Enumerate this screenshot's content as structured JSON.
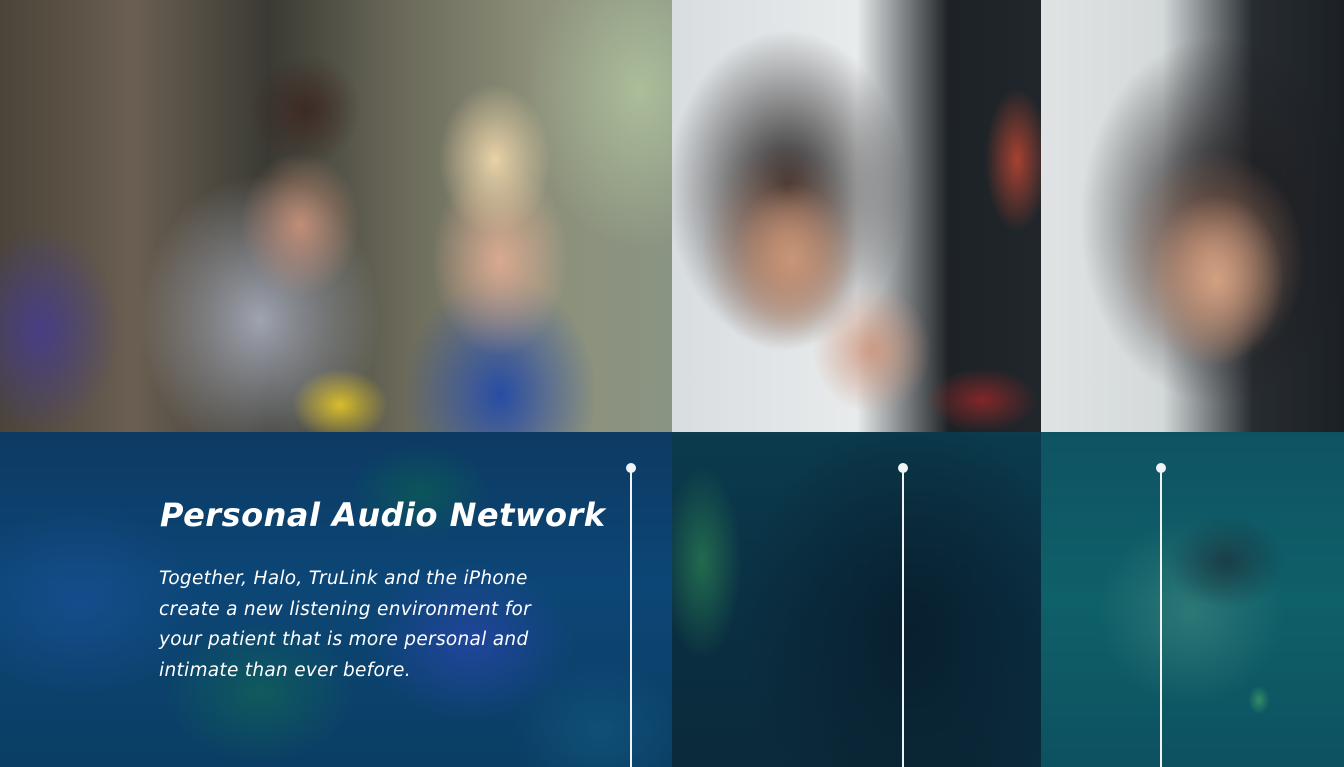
{
  "hero": {
    "title": "Personal Audio Network",
    "body": "Together, Halo, TruLink and the iPhone create a new listening environment for your patient that is more personal and intimate than ever before."
  },
  "photos": [
    {
      "subject": "blurred-couple-photo"
    },
    {
      "subject": "woman-on-phone-photo"
    },
    {
      "subject": "woman-looking-at-phone-photo"
    }
  ],
  "colors": {
    "overlay_blue": "#0c4676",
    "overlay_dark_teal": "#0a3043",
    "overlay_teal": "#0e6069",
    "line": "#f1f4f6",
    "text": "#ffffff"
  }
}
